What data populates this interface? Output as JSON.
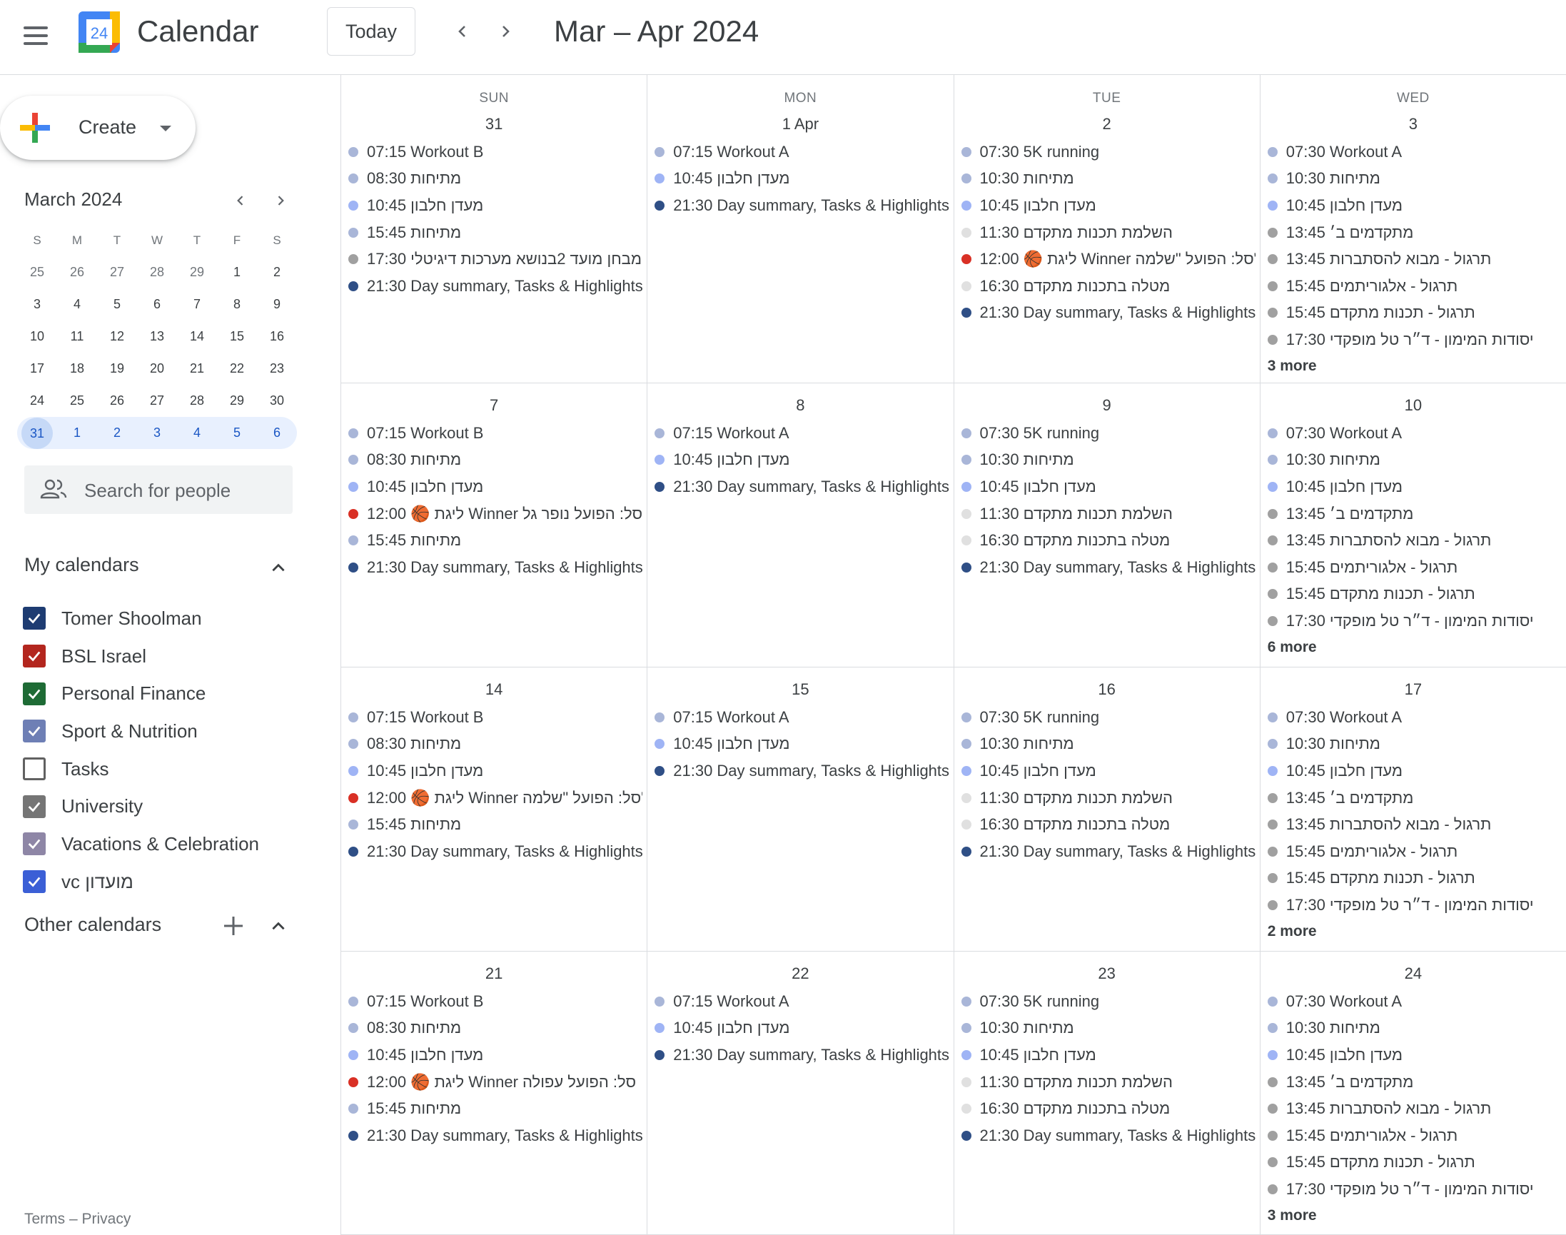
{
  "app": {
    "title": "Calendar",
    "logo_day": "24"
  },
  "header": {
    "today_label": "Today",
    "range_title": "Mar – Apr 2024"
  },
  "create": {
    "label": "Create"
  },
  "mini_calendar": {
    "title": "March 2024",
    "dow": [
      "S",
      "M",
      "T",
      "W",
      "T",
      "F",
      "S"
    ],
    "weeks": [
      [
        {
          "d": "25",
          "o": true
        },
        {
          "d": "26",
          "o": true
        },
        {
          "d": "27",
          "o": true
        },
        {
          "d": "28",
          "o": true
        },
        {
          "d": "29",
          "o": true
        },
        {
          "d": "1"
        },
        {
          "d": "2"
        }
      ],
      [
        {
          "d": "3"
        },
        {
          "d": "4"
        },
        {
          "d": "5"
        },
        {
          "d": "6"
        },
        {
          "d": "7"
        },
        {
          "d": "8"
        },
        {
          "d": "9"
        }
      ],
      [
        {
          "d": "10"
        },
        {
          "d": "11"
        },
        {
          "d": "12"
        },
        {
          "d": "13"
        },
        {
          "d": "14"
        },
        {
          "d": "15"
        },
        {
          "d": "16"
        }
      ],
      [
        {
          "d": "17"
        },
        {
          "d": "18"
        },
        {
          "d": "19"
        },
        {
          "d": "20"
        },
        {
          "d": "21"
        },
        {
          "d": "22"
        },
        {
          "d": "23"
        }
      ],
      [
        {
          "d": "24"
        },
        {
          "d": "25"
        },
        {
          "d": "26"
        },
        {
          "d": "27"
        },
        {
          "d": "28"
        },
        {
          "d": "29"
        },
        {
          "d": "30"
        }
      ],
      [
        {
          "d": "31",
          "today": true
        },
        {
          "d": "1"
        },
        {
          "d": "2"
        },
        {
          "d": "3"
        },
        {
          "d": "4"
        },
        {
          "d": "5"
        },
        {
          "d": "6"
        }
      ]
    ]
  },
  "search_people": {
    "placeholder": "Search for people"
  },
  "my_calendars": {
    "title": "My calendars",
    "items": [
      {
        "label": "Tomer Shoolman",
        "color": "#1e3c72",
        "checked": true
      },
      {
        "label": "BSL Israel",
        "color": "#b3261e",
        "checked": true
      },
      {
        "label": "Personal Finance",
        "color": "#1e6b35",
        "checked": true
      },
      {
        "label": "Sport & Nutrition",
        "color": "#6e7fb5",
        "checked": true
      },
      {
        "label": "Tasks",
        "color": "#616161",
        "checked": false
      },
      {
        "label": "University",
        "color": "#757575",
        "checked": true
      },
      {
        "label": "Vacations & Celebration",
        "color": "#8e86a6",
        "checked": true
      },
      {
        "label": "vc מועדון",
        "color": "#3b5fd6",
        "checked": true
      }
    ]
  },
  "other_calendars": {
    "title": "Other calendars"
  },
  "footer": {
    "text": "Terms – Privacy"
  },
  "colors": {
    "sport": "#a9b6d8",
    "club": "#9fb4f5",
    "summary": "#2f4f86",
    "university": "#a0a0a0",
    "task": "#e0e0e0",
    "bsl": "#d93025"
  },
  "grid": {
    "dow": [
      "SUN",
      "MON",
      "TUE",
      "WED"
    ],
    "weeks": [
      {
        "days": [
          {
            "num": "31",
            "events": [
              {
                "c": "sport",
                "t": "07:15 Workout B"
              },
              {
                "c": "sport",
                "t": "08:30 מתיחות"
              },
              {
                "c": "club",
                "t": "10:45 מעדן חלבון"
              },
              {
                "c": "sport",
                "t": "15:45 מתיחות"
              },
              {
                "c": "university",
                "t": "17:30 מבחן מועד 2בנושא מערכות דיגיטלי"
              },
              {
                "c": "summary",
                "t": "21:30 Day summary, Tasks & Highlights"
              }
            ]
          },
          {
            "num": "1 Apr",
            "events": [
              {
                "c": "sport",
                "t": "07:15 Workout A"
              },
              {
                "c": "club",
                "t": "10:45 מעדן חלבון"
              },
              {
                "c": "summary",
                "t": "21:30 Day summary, Tasks & Highlights"
              }
            ]
          },
          {
            "num": "2",
            "events": [
              {
                "c": "sport",
                "t": "07:30 5K running"
              },
              {
                "c": "sport",
                "t": "10:30 מתיחות"
              },
              {
                "c": "club",
                "t": "10:45 מעדן חלבון"
              },
              {
                "c": "task",
                "t": "11:30 השלמת תכנות מתקדם"
              },
              {
                "c": "bsl",
                "t": "12:00 🏀 ליגת Winner סל: הפועל \"שלמה\""
              },
              {
                "c": "task",
                "t": "16:30 מטלה בתכנות מתקדם"
              },
              {
                "c": "summary",
                "t": "21:30 Day summary, Tasks & Highlights"
              }
            ]
          },
          {
            "num": "3",
            "events": [
              {
                "c": "sport",
                "t": "07:30 Workout A"
              },
              {
                "c": "sport",
                "t": "10:30 מתיחות"
              },
              {
                "c": "club",
                "t": "10:45 מעדן חלבון"
              },
              {
                "c": "university",
                "t": "13:45 מתקדמים ב׳"
              },
              {
                "c": "university",
                "t": "13:45 תרגול - מבוא להסתברות"
              },
              {
                "c": "university",
                "t": "15:45 תרגול - אלגוריתמים"
              },
              {
                "c": "university",
                "t": "15:45 תרגול - תכנות מתקדם"
              },
              {
                "c": "university",
                "t": "17:30 יסודות המימון - ד״ר טל מופקדי"
              }
            ],
            "more": "3 more"
          }
        ]
      },
      {
        "days": [
          {
            "num": "7",
            "events": [
              {
                "c": "sport",
                "t": "07:15 Workout B"
              },
              {
                "c": "sport",
                "t": "08:30 מתיחות"
              },
              {
                "c": "club",
                "t": "10:45 מעדן חלבון"
              },
              {
                "c": "bsl",
                "t": "12:00 🏀 ליגת Winner סל: הפועל נופר גל"
              },
              {
                "c": "sport",
                "t": "15:45 מתיחות"
              },
              {
                "c": "summary",
                "t": "21:30 Day summary, Tasks & Highlights"
              }
            ]
          },
          {
            "num": "8",
            "events": [
              {
                "c": "sport",
                "t": "07:15 Workout A"
              },
              {
                "c": "club",
                "t": "10:45 מעדן חלבון"
              },
              {
                "c": "summary",
                "t": "21:30 Day summary, Tasks & Highlights"
              }
            ]
          },
          {
            "num": "9",
            "events": [
              {
                "c": "sport",
                "t": "07:30 5K running"
              },
              {
                "c": "sport",
                "t": "10:30 מתיחות"
              },
              {
                "c": "club",
                "t": "10:45 מעדן חלבון"
              },
              {
                "c": "task",
                "t": "11:30 השלמת תכנות מתקדם"
              },
              {
                "c": "task",
                "t": "16:30 מטלה בתכנות מתקדם"
              },
              {
                "c": "summary",
                "t": "21:30 Day summary, Tasks & Highlights"
              }
            ]
          },
          {
            "num": "10",
            "events": [
              {
                "c": "sport",
                "t": "07:30 Workout A"
              },
              {
                "c": "sport",
                "t": "10:30 מתיחות"
              },
              {
                "c": "club",
                "t": "10:45 מעדן חלבון"
              },
              {
                "c": "university",
                "t": "13:45 מתקדמים ב׳"
              },
              {
                "c": "university",
                "t": "13:45 תרגול - מבוא להסתברות"
              },
              {
                "c": "university",
                "t": "15:45 תרגול - אלגוריתמים"
              },
              {
                "c": "university",
                "t": "15:45 תרגול - תכנות מתקדם"
              },
              {
                "c": "university",
                "t": "17:30 יסודות המימון - ד״ר טל מופקדי"
              }
            ],
            "more": "6 more"
          }
        ]
      },
      {
        "days": [
          {
            "num": "14",
            "events": [
              {
                "c": "sport",
                "t": "07:15 Workout B"
              },
              {
                "c": "sport",
                "t": "08:30 מתיחות"
              },
              {
                "c": "club",
                "t": "10:45 מעדן חלבון"
              },
              {
                "c": "bsl",
                "t": "12:00 🏀 ליגת Winner סל: הפועל \"שלמה\""
              },
              {
                "c": "sport",
                "t": "15:45 מתיחות"
              },
              {
                "c": "summary",
                "t": "21:30 Day summary, Tasks & Highlights"
              }
            ]
          },
          {
            "num": "15",
            "events": [
              {
                "c": "sport",
                "t": "07:15 Workout A"
              },
              {
                "c": "club",
                "t": "10:45 מעדן חלבון"
              },
              {
                "c": "summary",
                "t": "21:30 Day summary, Tasks & Highlights"
              }
            ]
          },
          {
            "num": "16",
            "events": [
              {
                "c": "sport",
                "t": "07:30 5K running"
              },
              {
                "c": "sport",
                "t": "10:30 מתיחות"
              },
              {
                "c": "club",
                "t": "10:45 מעדן חלבון"
              },
              {
                "c": "task",
                "t": "11:30 השלמת תכנות מתקדם"
              },
              {
                "c": "task",
                "t": "16:30 מטלה בתכנות מתקדם"
              },
              {
                "c": "summary",
                "t": "21:30 Day summary, Tasks & Highlights"
              }
            ]
          },
          {
            "num": "17",
            "events": [
              {
                "c": "sport",
                "t": "07:30 Workout A"
              },
              {
                "c": "sport",
                "t": "10:30 מתיחות"
              },
              {
                "c": "club",
                "t": "10:45 מעדן חלבון"
              },
              {
                "c": "university",
                "t": "13:45 מתקדמים ב׳"
              },
              {
                "c": "university",
                "t": "13:45 תרגול - מבוא להסתברות"
              },
              {
                "c": "university",
                "t": "15:45 תרגול - אלגוריתמים"
              },
              {
                "c": "university",
                "t": "15:45 תרגול - תכנות מתקדם"
              },
              {
                "c": "university",
                "t": "17:30 יסודות המימון - ד״ר טל מופקדי"
              }
            ],
            "more": "2 more"
          }
        ]
      },
      {
        "days": [
          {
            "num": "21",
            "events": [
              {
                "c": "sport",
                "t": "07:15 Workout B"
              },
              {
                "c": "sport",
                "t": "08:30 מתיחות"
              },
              {
                "c": "club",
                "t": "10:45 מעדן חלבון"
              },
              {
                "c": "bsl",
                "t": "12:00 🏀 ליגת Winner סל: הפועל עפולה"
              },
              {
                "c": "sport",
                "t": "15:45 מתיחות"
              },
              {
                "c": "summary",
                "t": "21:30 Day summary, Tasks & Highlights"
              }
            ]
          },
          {
            "num": "22",
            "events": [
              {
                "c": "sport",
                "t": "07:15 Workout A"
              },
              {
                "c": "club",
                "t": "10:45 מעדן חלבון"
              },
              {
                "c": "summary",
                "t": "21:30 Day summary, Tasks & Highlights"
              }
            ]
          },
          {
            "num": "23",
            "events": [
              {
                "c": "sport",
                "t": "07:30 5K running"
              },
              {
                "c": "sport",
                "t": "10:30 מתיחות"
              },
              {
                "c": "club",
                "t": "10:45 מעדן חלבון"
              },
              {
                "c": "task",
                "t": "11:30 השלמת תכנות מתקדם"
              },
              {
                "c": "task",
                "t": "16:30 מטלה בתכנות מתקדם"
              },
              {
                "c": "summary",
                "t": "21:30 Day summary, Tasks & Highlights"
              }
            ]
          },
          {
            "num": "24",
            "events": [
              {
                "c": "sport",
                "t": "07:30 Workout A"
              },
              {
                "c": "sport",
                "t": "10:30 מתיחות"
              },
              {
                "c": "club",
                "t": "10:45 מעדן חלבון"
              },
              {
                "c": "university",
                "t": "13:45 מתקדמים ב׳"
              },
              {
                "c": "university",
                "t": "13:45 תרגול - מבוא להסתברות"
              },
              {
                "c": "university",
                "t": "15:45 תרגול - אלגוריתמים"
              },
              {
                "c": "university",
                "t": "15:45 תרגול - תכנות מתקדם"
              },
              {
                "c": "university",
                "t": "17:30 יסודות המימון - ד״ר טל מופקדי"
              }
            ],
            "more": "3 more"
          }
        ]
      }
    ]
  }
}
